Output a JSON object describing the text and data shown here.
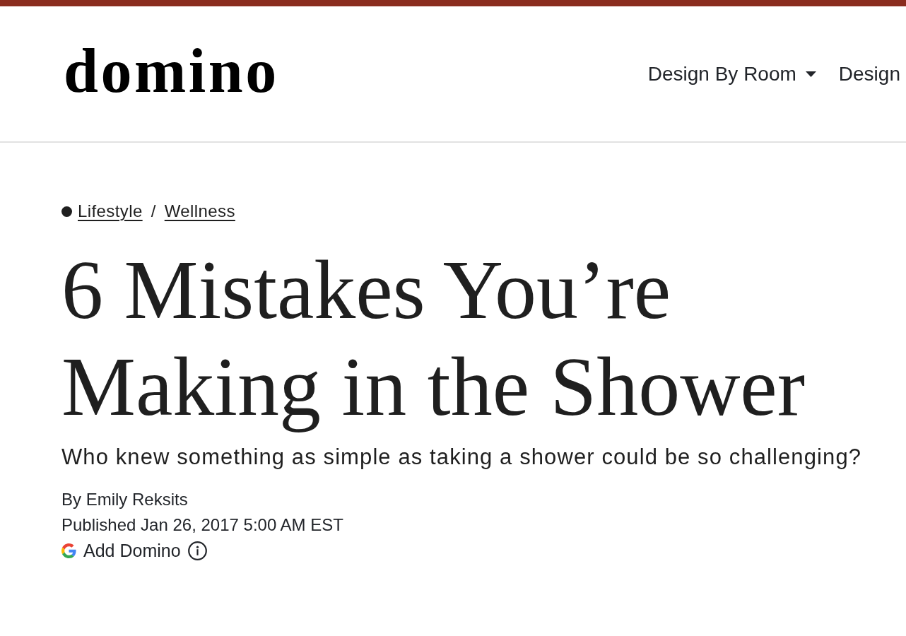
{
  "logo": "domino",
  "nav": [
    {
      "label": "Design By Room",
      "has_dropdown": true
    },
    {
      "label": "Design",
      "has_dropdown": false
    }
  ],
  "breadcrumb": {
    "items": [
      {
        "label": "Lifestyle"
      },
      {
        "label": "Wellness"
      }
    ],
    "separator": "/"
  },
  "article": {
    "title": "6 Mistakes You’re Making in the Shower",
    "subtitle": "Who knew something as simple as taking a shower could be so challenging?",
    "byline": "By Emily Reksits",
    "published": "Published Jan 26, 2017 5:00 AM EST",
    "follow_button": {
      "label": "Add Domino"
    }
  }
}
